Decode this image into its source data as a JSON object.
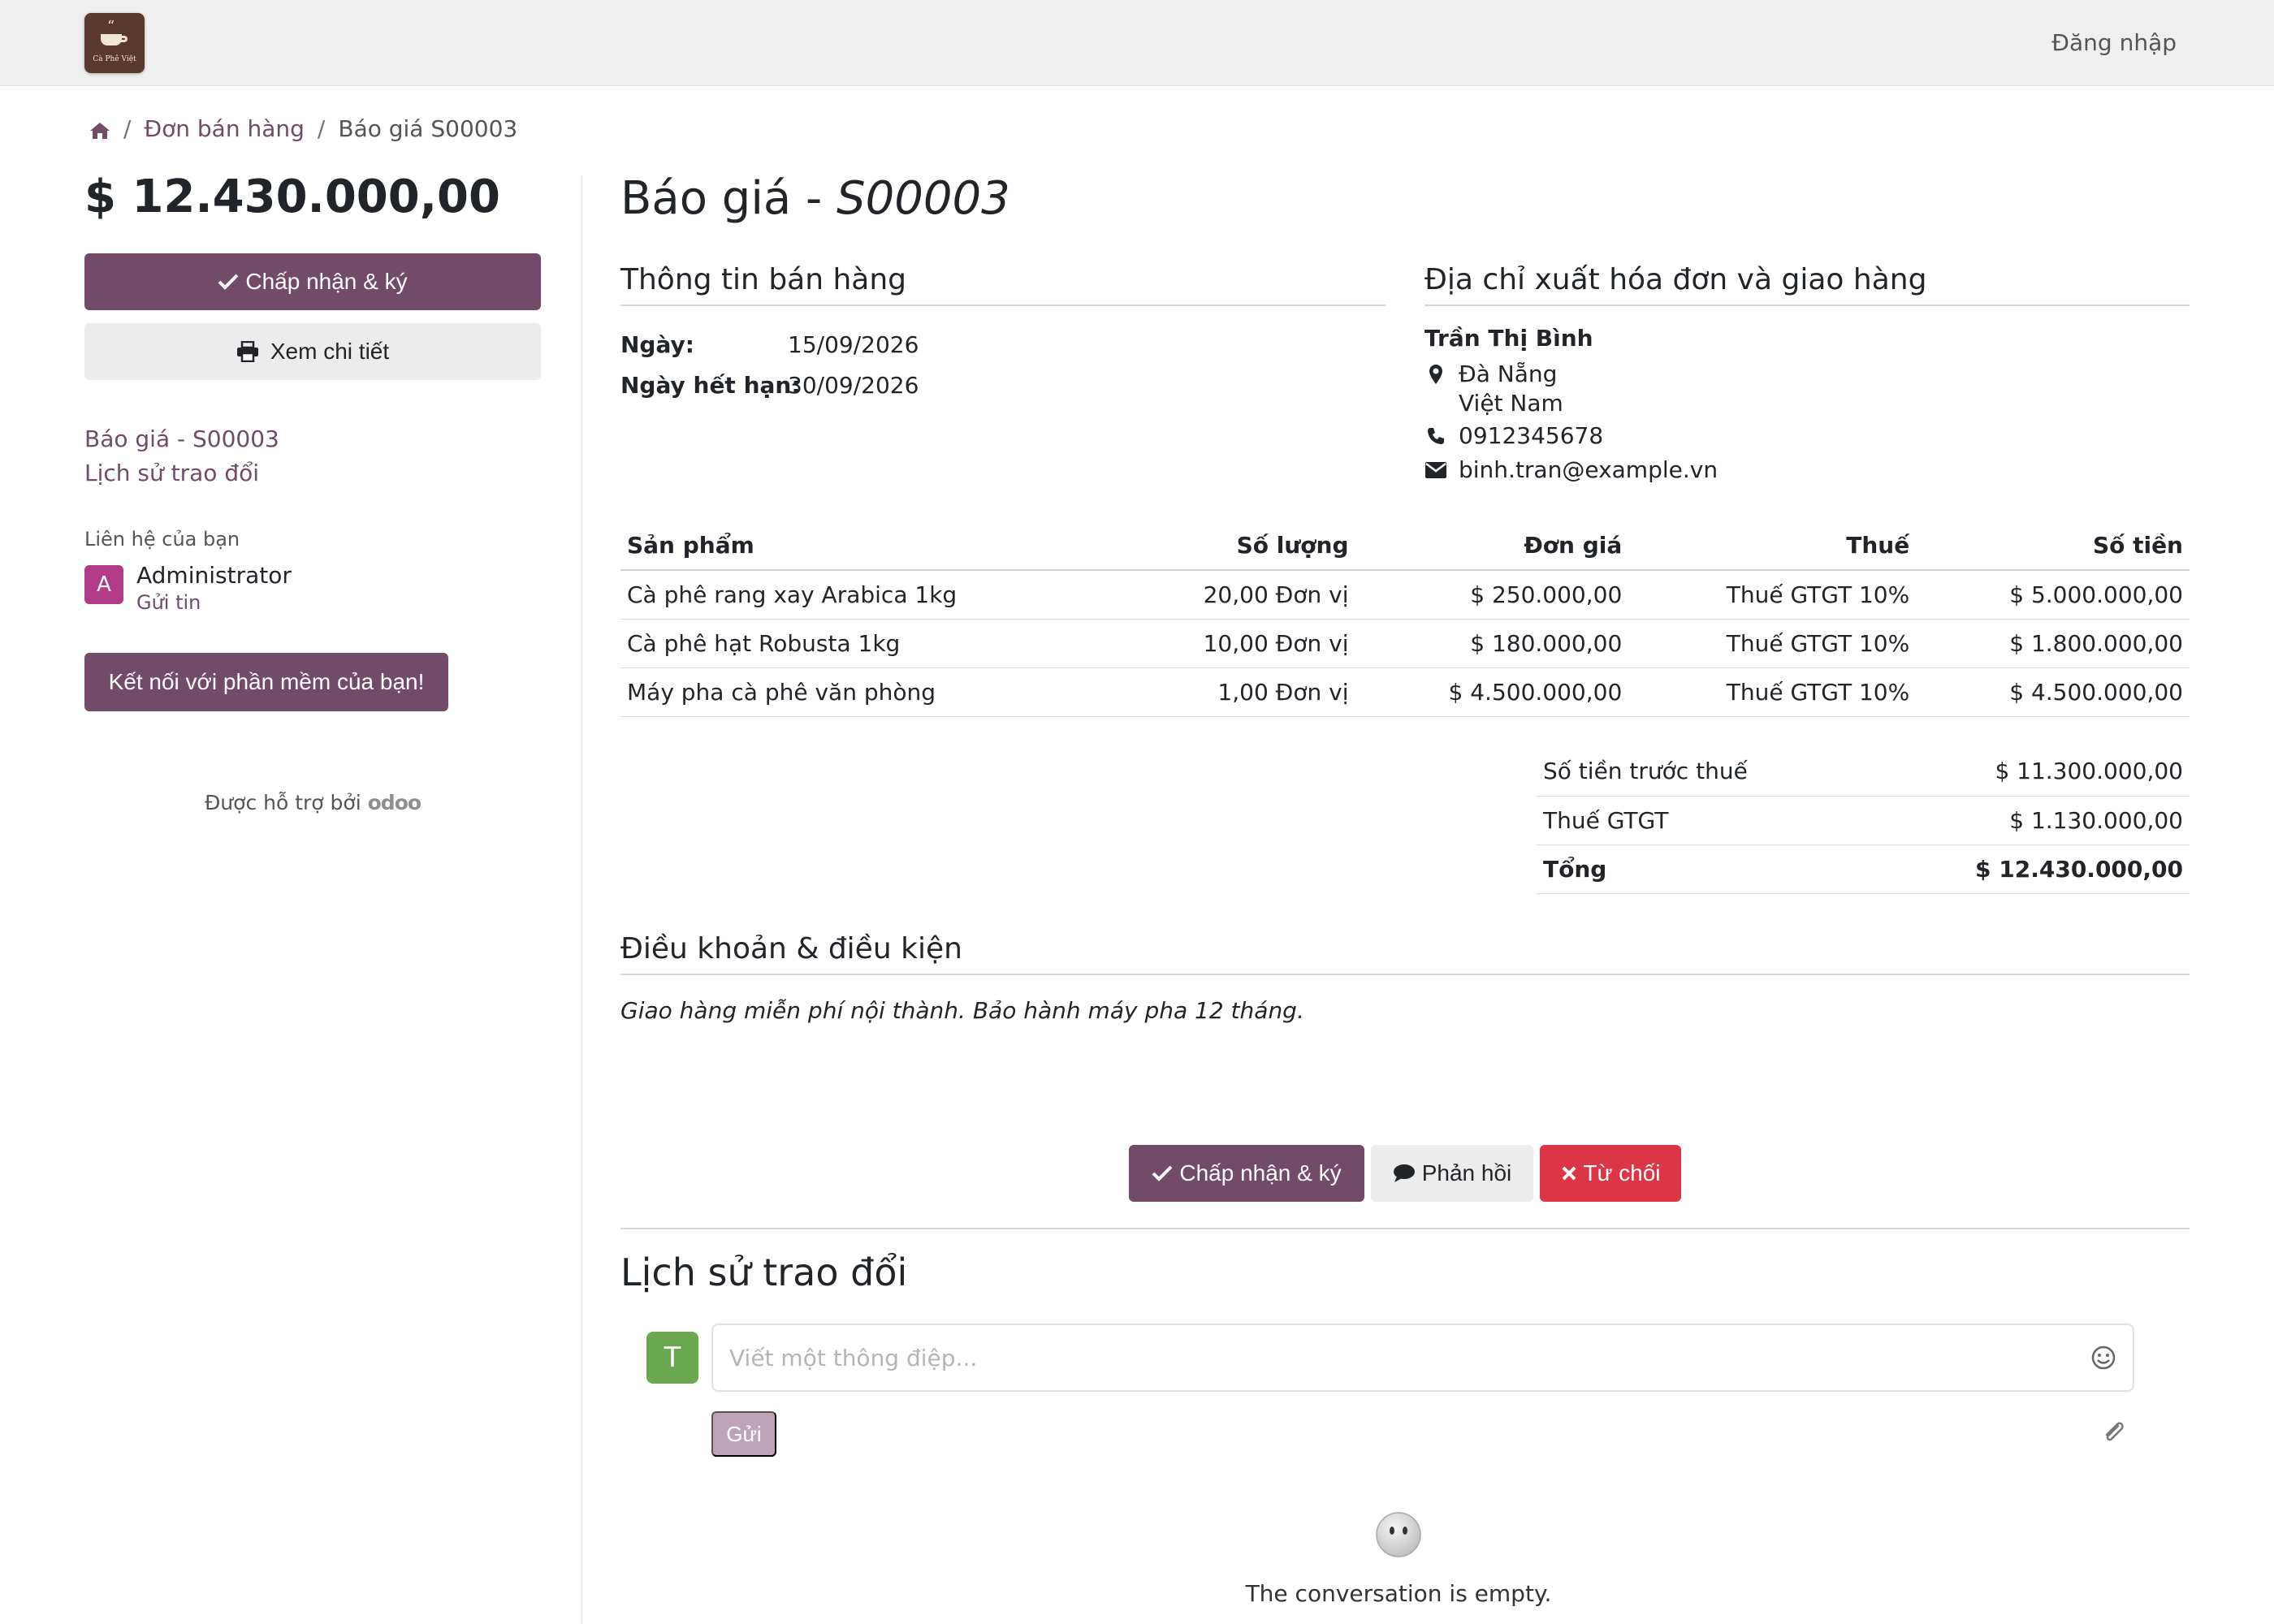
{
  "header": {
    "logo_text": "Cà Phê Việt",
    "login_label": "Đăng nhập"
  },
  "breadcrumb": {
    "home_icon": "home-icon",
    "parent": "Đơn bán hàng",
    "current": "Báo giá S00003"
  },
  "sidebar": {
    "total": "$ 12.430.000,00",
    "accept_label": "Chấp nhận & ký",
    "print_label": "Xem chi tiết",
    "nav_links": [
      "Báo giá - S00003",
      "Lịch sử trao đổi"
    ],
    "contact_label": "Liên hệ của bạn",
    "contact_initial": "A",
    "contact_name": "Administrator",
    "contact_action": "Gửi tin",
    "connect_label": "Kết nối với phần mềm của bạn!",
    "powered_by": "Được hỗ trợ bởi",
    "powered_brand": "odoo"
  },
  "document": {
    "title_prefix": "Báo giá - ",
    "title_ref": "S00003",
    "sale_info_title": "Thông tin bán hàng",
    "date_label": "Ngày:",
    "date_value": "15/09/2026",
    "expiry_label": "Ngày hết hạn:",
    "expiry_value": "30/09/2026",
    "address_title": "Địa chỉ xuất hóa đơn và giao hàng",
    "customer_name": "Trần Thị Bình",
    "city": "Đà Nẵng",
    "country": "Việt Nam",
    "phone": "0912345678",
    "email": "binh.tran@example.vn"
  },
  "lines": {
    "headers": {
      "product": "Sản phẩm",
      "qty": "Số lượng",
      "price": "Đơn giá",
      "tax": "Thuế",
      "amount": "Số tiền"
    },
    "rows": [
      {
        "product": "Cà phê rang xay Arabica 1kg",
        "qty": "20,00 Đơn vị",
        "price": "$ 250.000,00",
        "tax": "Thuế GTGT 10%",
        "amount": "$ 5.000.000,00"
      },
      {
        "product": "Cà phê hạt Robusta 1kg",
        "qty": "10,00 Đơn vị",
        "price": "$ 180.000,00",
        "tax": "Thuế GTGT 10%",
        "amount": "$ 1.800.000,00"
      },
      {
        "product": "Máy pha cà phê văn phòng",
        "qty": "1,00 Đơn vị",
        "price": "$ 4.500.000,00",
        "tax": "Thuế GTGT 10%",
        "amount": "$ 4.500.000,00"
      }
    ]
  },
  "totals": {
    "untaxed_label": "Số tiền trước thuế",
    "untaxed_value": "$ 11.300.000,00",
    "tax_label": "Thuế GTGT",
    "tax_value": "$ 1.130.000,00",
    "total_label": "Tổng",
    "total_value": "$ 12.430.000,00"
  },
  "terms": {
    "title": "Điều khoản & điều kiện",
    "text": "Giao hàng miễn phí nội thành. Bảo hành máy pha 12 tháng."
  },
  "actions": {
    "accept_label": "Chấp nhận & ký",
    "reply_label": "Phản hồi",
    "reject_label": "Từ chối"
  },
  "chatter": {
    "title": "Lịch sử trao đổi",
    "user_initial": "T",
    "placeholder": "Viết một thông điệp...",
    "send_label": "Gửi",
    "empty_text": "The conversation is empty."
  },
  "colors": {
    "brand": "#714b67",
    "danger": "#dc3545",
    "navbar": "#efefef"
  }
}
